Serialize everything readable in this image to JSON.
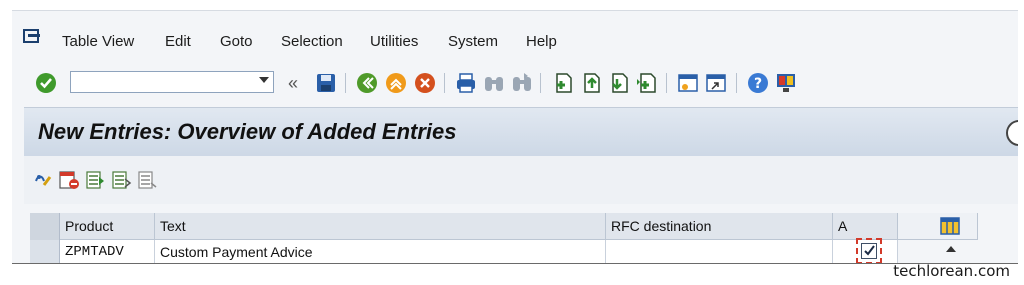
{
  "menu": {
    "items": [
      {
        "label": "Table View"
      },
      {
        "label": "Edit"
      },
      {
        "label": "Goto"
      },
      {
        "label": "Selection"
      },
      {
        "label": "Utilities"
      },
      {
        "label": "System"
      },
      {
        "label": "Help"
      }
    ]
  },
  "toolbar": {
    "command_field_value": "",
    "more_glyph": "«"
  },
  "screen": {
    "title": "New Entries: Overview of Added Entries"
  },
  "table": {
    "headers": [
      "Product",
      "Text",
      "RFC destination",
      "A"
    ],
    "rows": [
      {
        "product": "ZPMTADV",
        "text": "Custom Payment Advice",
        "rfc": "",
        "checked": true
      }
    ]
  },
  "watermark": "techlorean.com",
  "colors": {
    "accent": "#3a7ad4",
    "title_bg": "#d6dfea",
    "focus": "#d23a2a"
  },
  "icons": [
    "menu-icon",
    "enter-check-icon",
    "save-icon",
    "back-icon",
    "exit-icon",
    "cancel-icon",
    "print-icon",
    "find-icon",
    "find-next-icon",
    "first-page-icon",
    "previous-page-icon",
    "next-page-icon",
    "last-page-icon",
    "new-session-icon",
    "shortcut-icon",
    "help-icon",
    "layout-icon"
  ]
}
